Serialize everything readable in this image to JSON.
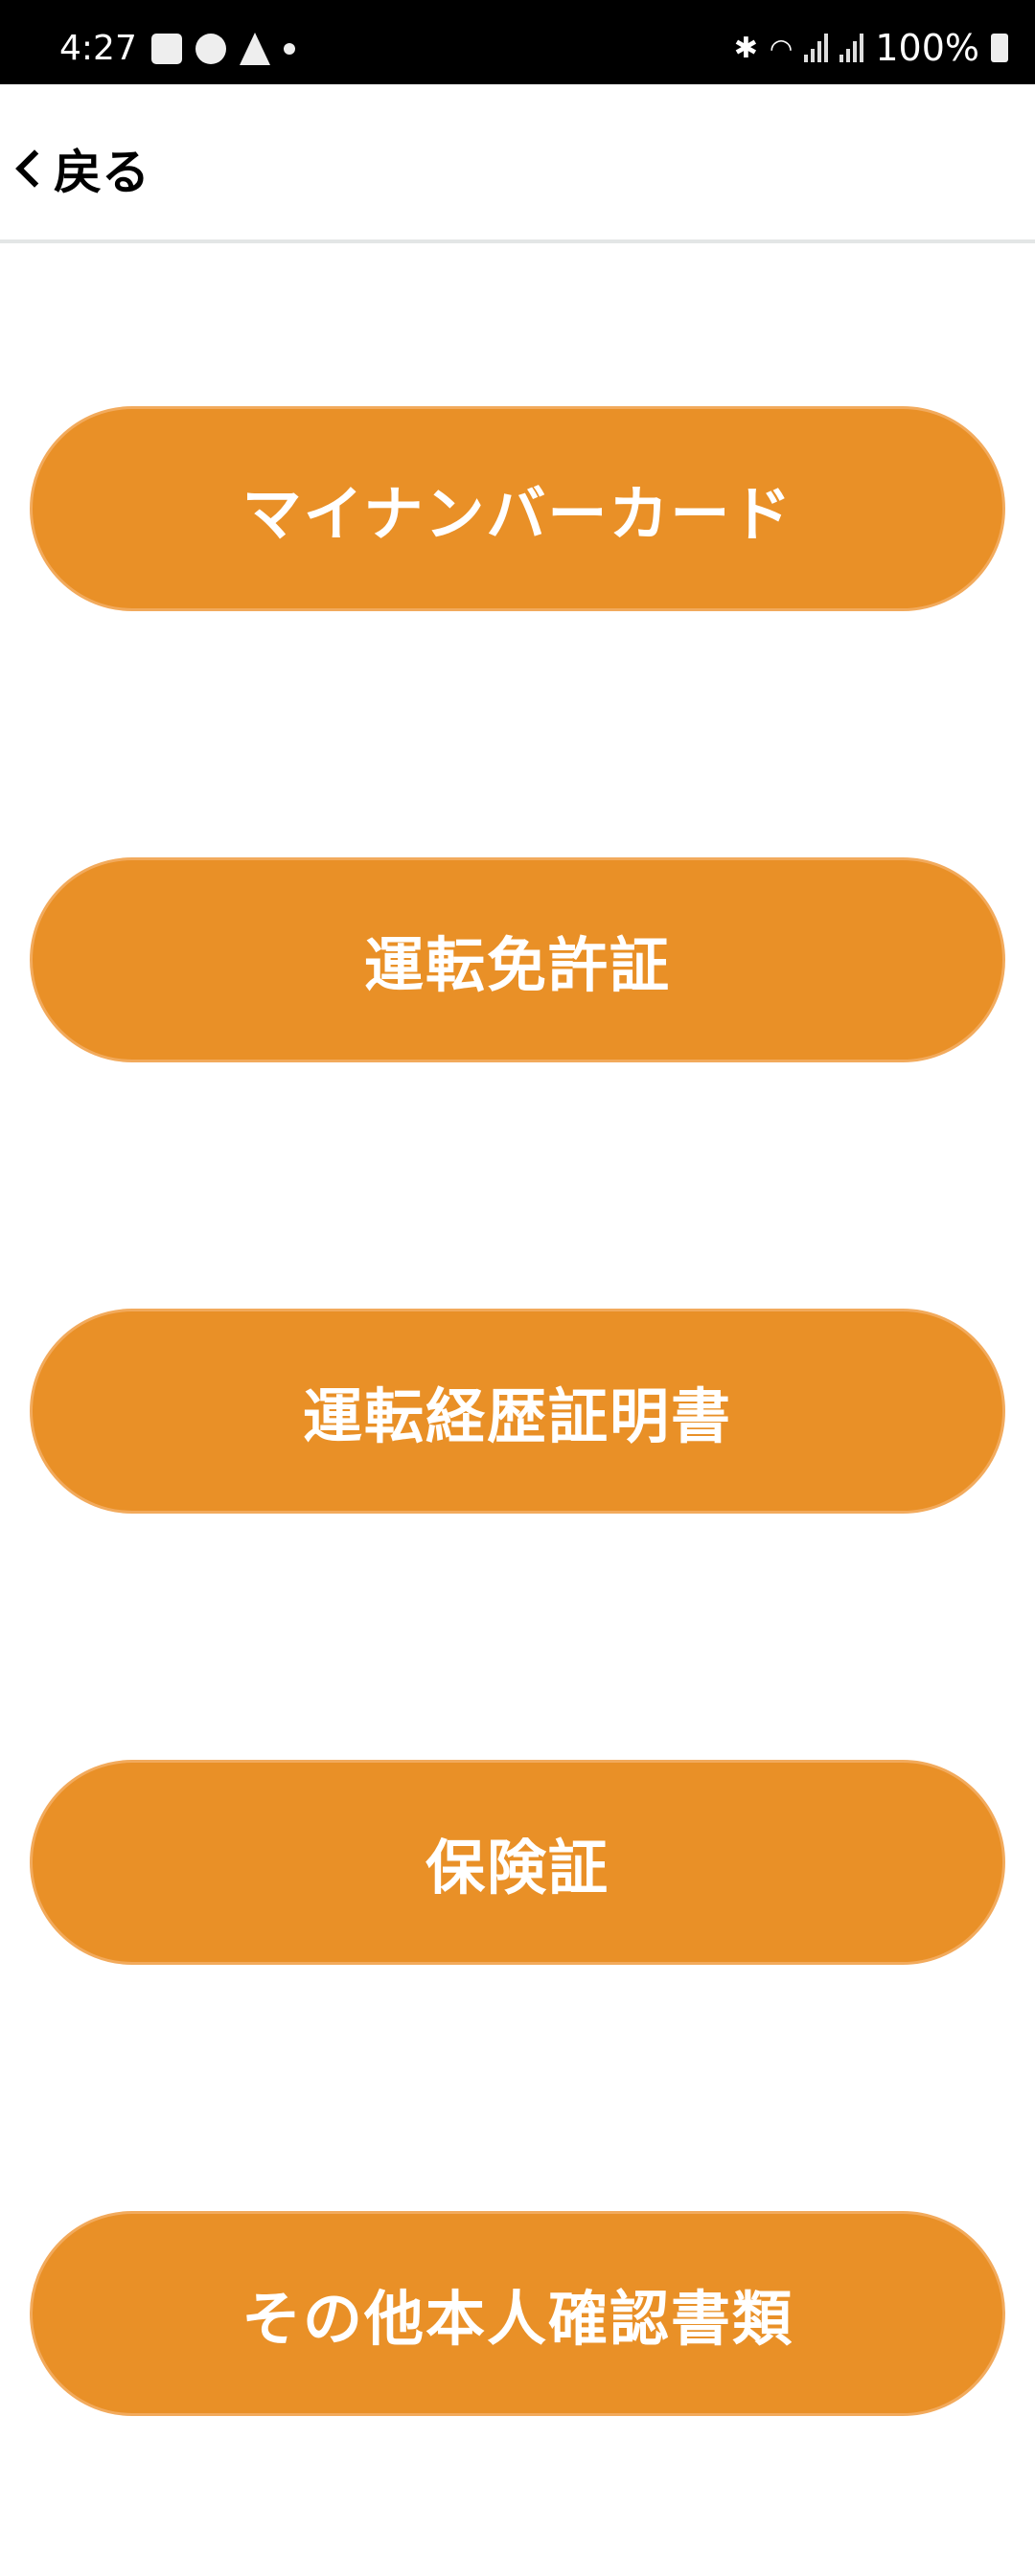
{
  "status_bar": {
    "time": "4:27",
    "battery": "100%"
  },
  "header": {
    "back_label": "戻る"
  },
  "buttons": [
    {
      "label": "マイナンバーカード"
    },
    {
      "label": "運転免許証"
    },
    {
      "label": "運転経歴証明書"
    },
    {
      "label": "保険証"
    },
    {
      "label": "その他本人確認書類"
    }
  ],
  "colors": {
    "button_bg": "#e99027",
    "button_border": "#f2aa5c",
    "button_text": "#ffffff"
  }
}
